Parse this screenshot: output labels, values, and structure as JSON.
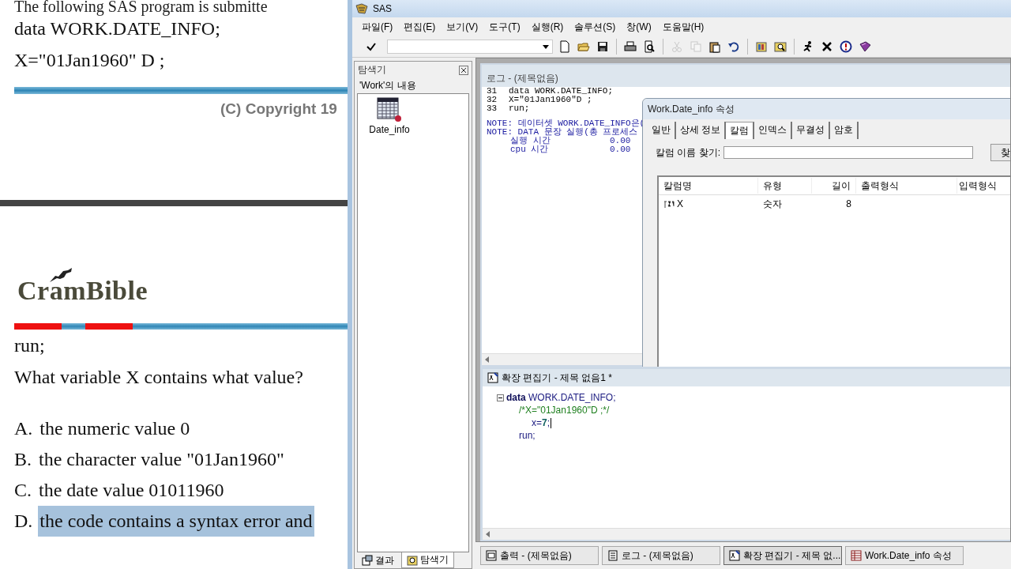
{
  "document": {
    "code_lines": [
      "The following SAS program is submitte",
      "data WORK.DATE_INFO;",
      "X=\"01Jan1960\" D ;"
    ],
    "copyright": "(C) Copyright 19",
    "logo": "CramBible",
    "question_lines": [
      "run;",
      "What variable X contains what value?"
    ],
    "options": [
      {
        "letter": "A.",
        "text": "the numeric value 0",
        "selected": false
      },
      {
        "letter": "B.",
        "text": "the character value \"01Jan1960\"",
        "selected": false
      },
      {
        "letter": "C.",
        "text": "the date value 01011960",
        "selected": false
      },
      {
        "letter": "D.",
        "text": "the code contains a syntax error and",
        "selected": true
      }
    ]
  },
  "sas_window": {
    "title": "SAS",
    "menu": [
      "파일(F)",
      "편집(E)",
      "보기(V)",
      "도구(T)",
      "실행(R)",
      "솔루션(S)",
      "창(W)",
      "도움말(H)"
    ],
    "toolbar": [
      {
        "disabled": false
      },
      {
        "disabled": false
      },
      {
        "disabled": false
      },
      {
        "disabled": false
      },
      {
        "disabled": false
      },
      {
        "disabled": true
      },
      {
        "disabled": true
      },
      {
        "disabled": false
      },
      {
        "disabled": false
      },
      {
        "disabled": false
      },
      {
        "disabled": false
      },
      {
        "disabled": false
      },
      {
        "disabled": false
      },
      {
        "disabled": false
      },
      {
        "disabled": false
      }
    ]
  },
  "explorer": {
    "title": "탐색기",
    "heading": "'Work'의 내용",
    "items": [
      {
        "label": "Date_info"
      }
    ],
    "tabs": [
      {
        "label": "결과",
        "selected": false
      },
      {
        "label": "탐색기",
        "selected": true
      }
    ]
  },
  "log_window": {
    "title": "로그 - (제목없음)",
    "lines": [
      {
        "kind": "source",
        "number": "31",
        "text": "data WORK.DATE_INFO;"
      },
      {
        "kind": "source",
        "number": "32",
        "text": "X=\"01Jan1960\"D ;"
      },
      {
        "kind": "source",
        "number": "33",
        "text": "run;"
      },
      {
        "kind": "blank"
      },
      {
        "kind": "note",
        "text": "NOTE: 데이터셋 WORK.DATE_INFO은("
      },
      {
        "kind": "note",
        "text": "NOTE: DATA 문장 실행(총 프로세스"
      },
      {
        "kind": "timing",
        "text": "실행 시간",
        "value": "0.00"
      },
      {
        "kind": "timing",
        "text": "cpu 시간",
        "value": "0.00"
      }
    ]
  },
  "properties_dialog": {
    "title": "Work.Date_info 속성",
    "tabs": [
      {
        "label": "일반",
        "selected": false
      },
      {
        "label": "상세 정보",
        "selected": false
      },
      {
        "label": "칼럼",
        "selected": true
      },
      {
        "label": "인덱스",
        "selected": false
      },
      {
        "label": "무결성",
        "selected": false
      },
      {
        "label": "암호",
        "selected": false
      }
    ],
    "find_label": "칼럼 이름 찾기:",
    "find_button": "찾",
    "table": {
      "columns": [
        "칼럼명",
        "유형",
        "길이",
        "출력형식",
        "입력형식"
      ],
      "rows": [
        [
          "X",
          "숫자",
          "8",
          "",
          ""
        ]
      ]
    }
  },
  "editor": {
    "title": "확장 편집기 - 제목 없음1 *",
    "lines": [
      {
        "fold": true,
        "tokens": [
          {
            "kind": "keyword",
            "text": "data"
          },
          {
            "kind": "plain",
            "text": " WORK.DATE_INFO;"
          }
        ],
        "children": [
          {
            "fold": false,
            "tokens": [
              {
                "kind": "comment",
                "text": "/*X=\"01Jan1960\"D ;*/"
              }
            ],
            "children": [
              {
                "fold": false,
                "cursor": true,
                "tokens": [
                  {
                    "kind": "plain",
                    "text": "x="
                  },
                  {
                    "kind": "number",
                    "text": "7"
                  },
                  {
                    "kind": "plain",
                    "text": ";"
                  }
                ]
              }
            ]
          },
          {
            "fold": false,
            "tokens": [
              {
                "kind": "plain",
                "text": "run;"
              }
            ]
          }
        ]
      }
    ]
  },
  "taskbar": [
    {
      "kind": "output",
      "label": "출력 - (제목없음)",
      "selected": false
    },
    {
      "kind": "log",
      "label": "로그 - (제목없음)",
      "selected": false
    },
    {
      "kind": "editor",
      "label": "확장 편집기 - 제목 없...",
      "selected": true
    },
    {
      "kind": "table",
      "label": "Work.Date_info 속성",
      "selected": false
    }
  ]
}
